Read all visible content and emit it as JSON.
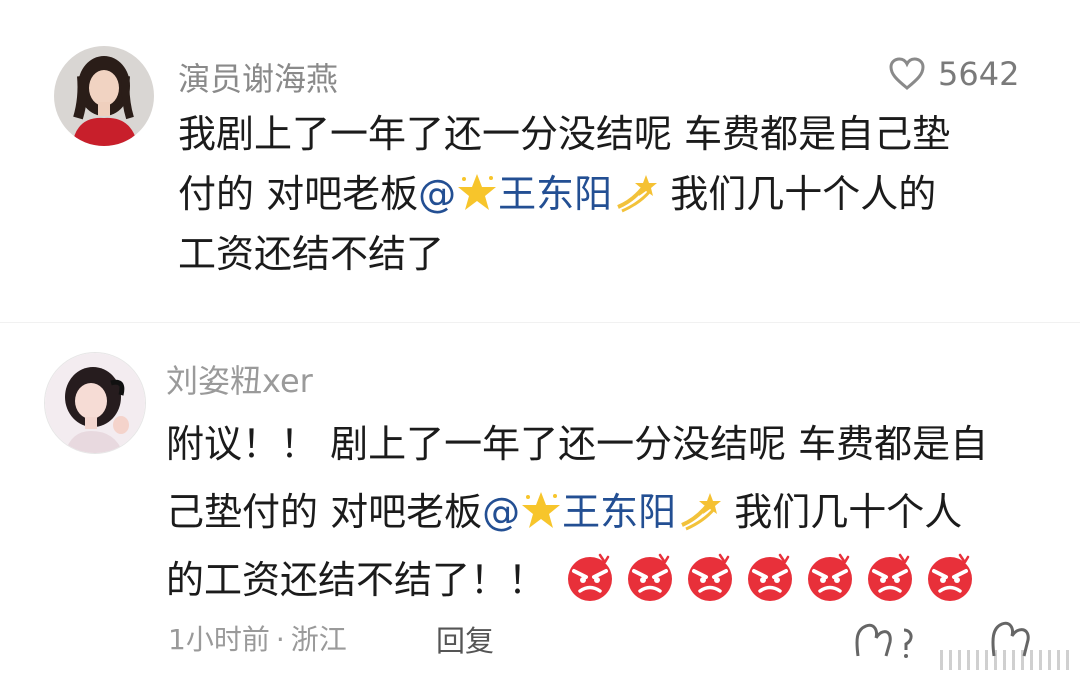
{
  "comment1": {
    "username": "演员谢海燕",
    "likes": "5642",
    "text_lines": [
      "我剧上了一年了还一分没结呢 车费都是自己垫",
      "付的 对吧老板",
      "工资还结不结了"
    ],
    "mention_prefix": "@",
    "mention_name": "王东阳",
    "after_mention": " 我们几十个人的"
  },
  "comment2": {
    "username": "刘姿粈xer",
    "line1": "附议！！ 剧上了一年了还一分没结呢 车费都是自",
    "line2_before": "己垫付的 对吧老板",
    "mention_prefix": "@",
    "mention_name": "王东阳",
    "line2_after": " 我们几十个人",
    "line3": "的工资还结不结了！！",
    "angry_emoji_count": 7,
    "time": "1小时前",
    "sep": "·",
    "location": "浙江",
    "reply_label": "回复"
  },
  "colors": {
    "mention": "#234f93",
    "username": "#8a8a8a",
    "meta": "#9a9a9a",
    "angry_face": "#e8303a"
  },
  "icons": [
    "heart-outline-icon",
    "star-emoji-icon",
    "dizzy-emoji-icon",
    "angry-face-emoji-icon",
    "like-icon",
    "dislike-icon"
  ]
}
